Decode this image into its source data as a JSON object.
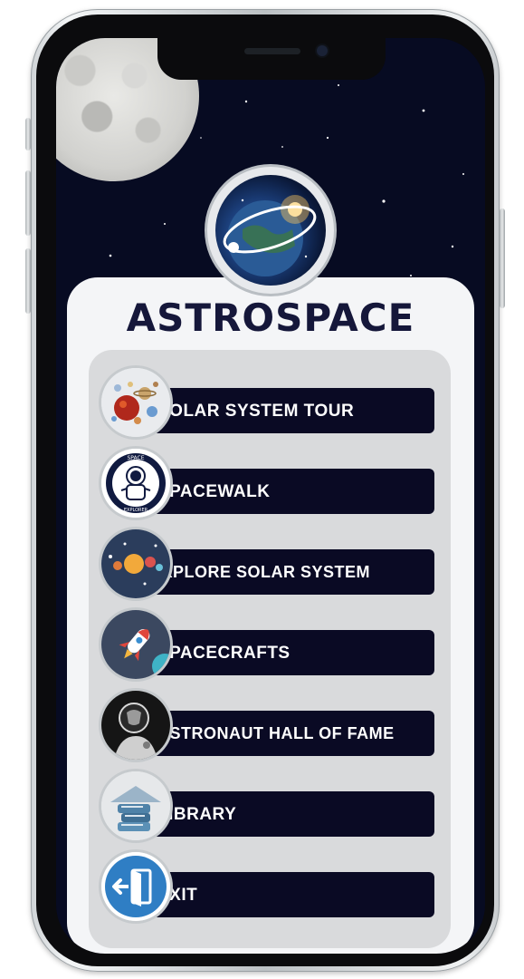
{
  "app": {
    "title": "ASTROSPACE",
    "logo_icon": "globe-orbit-icon",
    "background_icon": "moon-icon"
  },
  "menu": {
    "items": [
      {
        "label": "SOLAR SYSTEM TOUR",
        "icon": "planets-icon"
      },
      {
        "label": "SPACEWALK",
        "icon": "astronaut-badge-icon"
      },
      {
        "label": "EXPLORE SOLAR SYSTEM",
        "icon": "sun-planets-icon"
      },
      {
        "label": "SPACECRAFTS",
        "icon": "rocket-icon"
      },
      {
        "label": "ASTRONAUT HALL OF FAME",
        "icon": "astronaut-portrait-icon"
      },
      {
        "label": "LIBRARY",
        "icon": "books-icon"
      },
      {
        "label": "EXIT",
        "icon": "exit-door-icon"
      }
    ],
    "badge_text_top": "SPACE",
    "badge_text_bottom": "EXPLORER"
  },
  "colors": {
    "sky": "#070b22",
    "button": "#0a0a24",
    "title": "#15173a",
    "card": "#f4f5f7",
    "panel": "#d9dadc"
  }
}
